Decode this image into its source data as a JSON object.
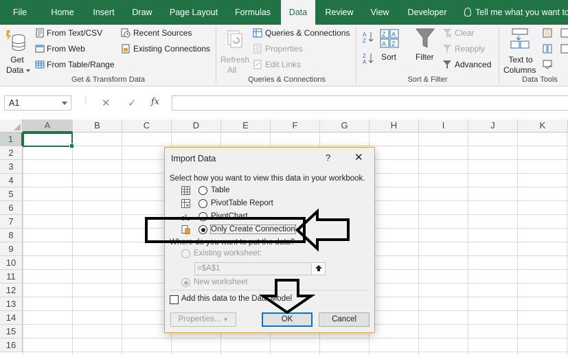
{
  "tabs": [
    "File",
    "Home",
    "Insert",
    "Draw",
    "Page Layout",
    "Formulas",
    "Data",
    "Review",
    "View",
    "Developer"
  ],
  "active_tab": "Data",
  "tell_me": "Tell me what you want to",
  "ribbon": {
    "get_data": {
      "line1": "Get",
      "line2": "Data"
    },
    "from_text_csv": "From Text/CSV",
    "from_web": "From Web",
    "from_table_range": "From Table/Range",
    "recent_sources": "Recent Sources",
    "existing_connections": "Existing Connections",
    "group_get_transform": "Get & Transform Data",
    "refresh_all": {
      "line1": "Refresh",
      "line2": "All"
    },
    "queries_connections": "Queries & Connections",
    "properties": "Properties",
    "edit_links": "Edit Links",
    "group_queries": "Queries & Connections",
    "sort": "Sort",
    "filter": "Filter",
    "clear": "Clear",
    "reapply": "Reapply",
    "advanced": "Advanced",
    "group_sort_filter": "Sort & Filter",
    "text_to_columns": {
      "line1": "Text to",
      "line2": "Columns"
    },
    "group_data_tools": "Data Tools"
  },
  "formula_bar": {
    "name_box": "A1",
    "fx": "fx",
    "cancel": "✕",
    "enter": "✓"
  },
  "columns": [
    "A",
    "B",
    "C",
    "D",
    "E",
    "F",
    "G",
    "H",
    "I",
    "J",
    "K"
  ],
  "rows": [
    "1",
    "2",
    "3",
    "4",
    "5",
    "6",
    "7",
    "8",
    "9",
    "10",
    "11",
    "12",
    "13",
    "14",
    "15",
    "16"
  ],
  "dialog": {
    "title": "Import Data",
    "help": "?",
    "close": "✕",
    "prompt": "Select how you want to view this data in your workbook.",
    "options": {
      "table": "Table",
      "pivot_report": "PivotTable Report",
      "pivot_chart": "PivotChart",
      "only_connection": "Only Create Connection"
    },
    "selected_option": "Only Create Connection",
    "where_prompt": "Where do you want to put the data?",
    "existing_worksheet": "Existing worksheet:",
    "range_value": "=$A$1",
    "new_worksheet": "New worksheet",
    "add_to_model": "Add this data to the Data Model",
    "add_to_model_checked": false,
    "properties_btn": "Properties...",
    "ok_btn": "OK",
    "cancel_btn": "Cancel"
  },
  "colors": {
    "excel_green": "#217346",
    "annotation": "#000000",
    "default_button_border": "#0078d7"
  }
}
